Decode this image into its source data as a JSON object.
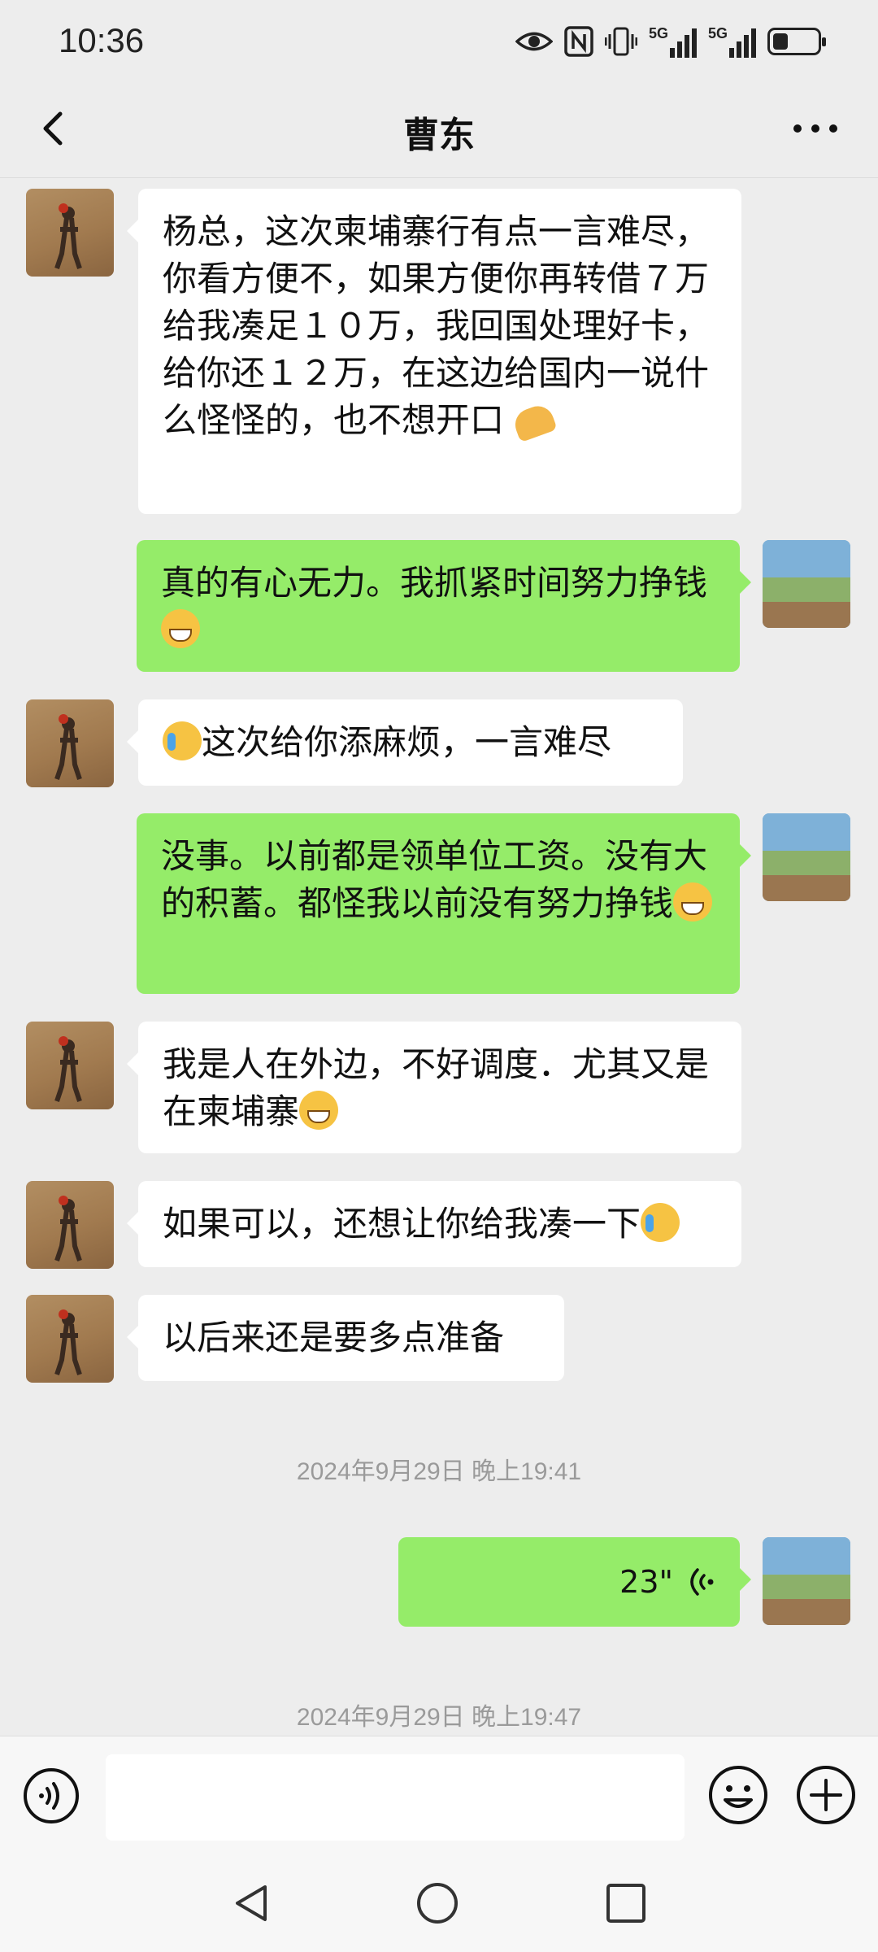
{
  "status_bar": {
    "time": "10:36",
    "network_1": "5G",
    "network_2": "5G",
    "icons": [
      "eye-icon",
      "nfc-icon",
      "vibrate-icon",
      "signal-icon",
      "signal-icon",
      "battery-icon"
    ],
    "battery_level": 0.35
  },
  "header": {
    "title": "曹东",
    "back_icon": "chevron-left-icon",
    "more_icon": "more-dots-icon"
  },
  "messages": [
    {
      "side": "incoming",
      "text": "杨总，这次柬埔寨行有点一言难尽，你看方便不，如果方便你再转借７万给我凑足１０万，我回国处理好卡，给你还１２万，在这边给国内一说什么怪怪的，也不想开口",
      "trailing_emoji": "folded-hands-emoji"
    },
    {
      "side": "outgoing",
      "text": "真的有心无力。我抓紧时间努力挣钱",
      "trailing_emoji": "grinning-emoji"
    },
    {
      "side": "incoming",
      "leading_emoji": "crying-laughing-emoji",
      "text": "这次给你添麻烦，一言难尽"
    },
    {
      "side": "outgoing",
      "text": "没事。以前都是领单位工资。没有大的积蓄。都怪我以前没有努力挣钱",
      "trailing_emoji": "grinning-emoji"
    },
    {
      "side": "incoming",
      "text": "我是人在外边，不好调度．尤其又是在柬埔寨",
      "trailing_emoji": "grinning-emoji"
    },
    {
      "side": "incoming",
      "text": "如果可以，还想让你给我凑一下",
      "trailing_emoji": "crying-laughing-emoji"
    },
    {
      "side": "incoming",
      "text": "以后来还是要多点准备"
    }
  ],
  "timestamps": [
    "2024年9月29日 晚上19:41",
    "2024年9月29日 晚上19:47"
  ],
  "voice_message": {
    "side": "outgoing",
    "duration": "23\"",
    "icon": "voice-wave-icon"
  },
  "input_bar": {
    "voice_icon": "voice-toggle-icon",
    "placeholder": "",
    "emoji_icon": "smiley-icon",
    "plus_icon": "plus-circle-icon"
  },
  "system_nav": {
    "back_icon": "triangle-back-icon",
    "home_icon": "circle-home-icon",
    "recent_icon": "square-recent-icon"
  },
  "colors": {
    "background": "#ededed",
    "incoming_bubble": "#ffffff",
    "outgoing_bubble": "#95ec69",
    "timestamp": "#9a9a9a"
  }
}
